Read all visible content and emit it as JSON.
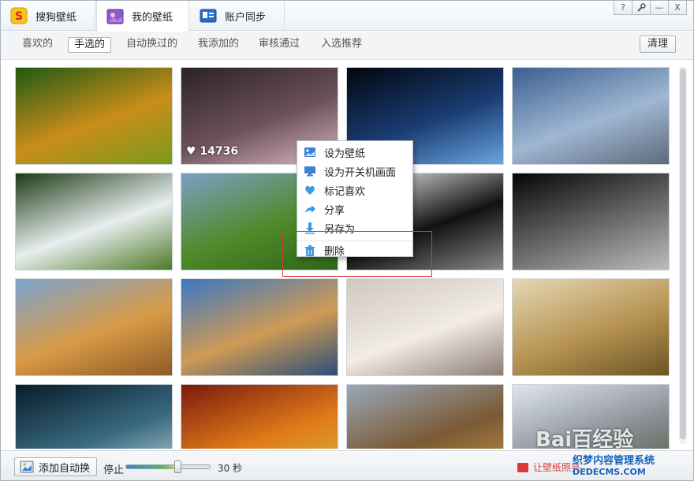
{
  "tabs": [
    {
      "label": "搜狗壁纸",
      "icon": "sogou-logo-icon"
    },
    {
      "label": "我的壁纸",
      "icon": "my-wallpaper-icon"
    },
    {
      "label": "账户同步",
      "icon": "account-sync-icon"
    }
  ],
  "window_controls": [
    {
      "label": "?",
      "icon": "help-icon"
    },
    {
      "label": "🔧",
      "icon": "wrench-icon"
    },
    {
      "label": "—",
      "icon": "minimize-icon"
    },
    {
      "label": "X",
      "icon": "close-icon"
    }
  ],
  "filters": [
    "喜欢的",
    "手选的",
    "自动换过的",
    "我添加的",
    "审核通过",
    "入选推荐"
  ],
  "active_filter": "手选的",
  "clear_label": "清理",
  "thumbnails": [
    {
      "name": "golden-hills",
      "c1": "#1f5a12",
      "c2": "#c98d1a",
      "c3": "#7a9a1c"
    },
    {
      "name": "anime-girl",
      "c1": "#2b2326",
      "c2": "#6c5158",
      "c3": "#d9b6c2",
      "likes": "14736"
    },
    {
      "name": "planet-space",
      "c1": "#02060f",
      "c2": "#1a3d73",
      "c3": "#6aa4e0"
    },
    {
      "name": "london-bridge",
      "c1": "#3b5f8f",
      "c2": "#9fb7d3",
      "c3": "#5d6a7a"
    },
    {
      "name": "waterfall",
      "c1": "#1c3a14",
      "c2": "#e8eef0",
      "c3": "#4d7a28"
    },
    {
      "name": "green-field",
      "c1": "#7aa0c4",
      "c2": "#4f8a2a",
      "c3": "#2e6618"
    },
    {
      "name": "ink-art",
      "c1": "#f4f4f4",
      "c2": "#111111",
      "c3": "#888888"
    },
    {
      "name": "dark-devil",
      "c1": "#050505",
      "c2": "#6a6a6a",
      "c3": "#bdbdbd"
    },
    {
      "name": "lighthouse-dunes",
      "c1": "#7ba4cf",
      "c2": "#d89a46",
      "c3": "#8c5a26"
    },
    {
      "name": "lake-mountains",
      "c1": "#3a78c2",
      "c2": "#cf9a55",
      "c3": "#2a4f78"
    },
    {
      "name": "sleeping-girl",
      "c1": "#cfc8c0",
      "c2": "#f2ebe6",
      "c3": "#8c7e74"
    },
    {
      "name": "wheat-field",
      "c1": "#e6d7b4",
      "c2": "#b69352",
      "c3": "#6c5424"
    },
    {
      "name": "moon-night",
      "c1": "#081c2a",
      "c2": "#3a6a80",
      "c3": "#c4d4d8"
    },
    {
      "name": "sunset-road",
      "c1": "#7a1a0c",
      "c2": "#e07a1a",
      "c3": "#d8b43a"
    },
    {
      "name": "canyon",
      "c1": "#9aa8ba",
      "c2": "#7a5a34",
      "c3": "#c49444"
    },
    {
      "name": "castle",
      "c1": "#dfe6ee",
      "c2": "#8a8f96",
      "c3": "#4a5a3a"
    }
  ],
  "context_menu": [
    {
      "label": "设为壁纸",
      "icon": "image-icon"
    },
    {
      "label": "设为开关机画面",
      "icon": "monitor-icon"
    },
    {
      "label": "标记喜欢",
      "icon": "heart-icon"
    },
    {
      "label": "分享",
      "icon": "share-arrow-icon"
    },
    {
      "label": "另存为",
      "icon": "download-icon"
    },
    {
      "label": "删除",
      "icon": "trash-icon"
    }
  ],
  "bottom": {
    "add_auto_label": "添加自动换",
    "stop_label": "停止",
    "interval_label": "30 秒",
    "slider_value": 0.62,
    "promo_label": "让壁纸照亮..."
  },
  "watermarks": {
    "baidu": "Bai百经验",
    "dede_line1": "织梦内容管理系统",
    "dede_line2": "DEDECMS.COM"
  },
  "colors": {
    "accent": "#3c82d6",
    "highlight_red": "#d23b3b"
  }
}
